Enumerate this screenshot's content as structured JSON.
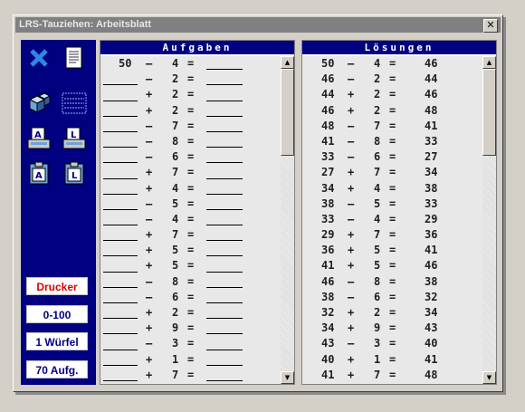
{
  "window": {
    "title": "LRS-Tauziehen: Arbeitsblatt",
    "close_label": "✕"
  },
  "sidebar": {
    "icons": [
      "close-x-icon",
      "document-icon",
      "cubes-icon",
      "grid-icon",
      "print-a-icon",
      "print-l-icon",
      "clipboard-a-icon",
      "clipboard-l-icon"
    ],
    "buttons": [
      {
        "label": "Drucker",
        "color": "#e00000"
      },
      {
        "label": "0-100"
      },
      {
        "label": "1 Würfel"
      },
      {
        "label": "70 Aufg."
      }
    ]
  },
  "tasks": {
    "header": "Aufgaben",
    "rows": [
      {
        "a": "50",
        "op": "–",
        "b": "4",
        "eq": "="
      },
      {
        "a": "",
        "op": "–",
        "b": "2",
        "eq": "="
      },
      {
        "a": "",
        "op": "+",
        "b": "2",
        "eq": "="
      },
      {
        "a": "",
        "op": "+",
        "b": "2",
        "eq": "="
      },
      {
        "a": "",
        "op": "–",
        "b": "7",
        "eq": "="
      },
      {
        "a": "",
        "op": "–",
        "b": "8",
        "eq": "="
      },
      {
        "a": "",
        "op": "–",
        "b": "6",
        "eq": "="
      },
      {
        "a": "",
        "op": "+",
        "b": "7",
        "eq": "="
      },
      {
        "a": "",
        "op": "+",
        "b": "4",
        "eq": "="
      },
      {
        "a": "",
        "op": "–",
        "b": "5",
        "eq": "="
      },
      {
        "a": "",
        "op": "–",
        "b": "4",
        "eq": "="
      },
      {
        "a": "",
        "op": "+",
        "b": "7",
        "eq": "="
      },
      {
        "a": "",
        "op": "+",
        "b": "5",
        "eq": "="
      },
      {
        "a": "",
        "op": "+",
        "b": "5",
        "eq": "="
      },
      {
        "a": "",
        "op": "–",
        "b": "8",
        "eq": "="
      },
      {
        "a": "",
        "op": "–",
        "b": "6",
        "eq": "="
      },
      {
        "a": "",
        "op": "+",
        "b": "2",
        "eq": "="
      },
      {
        "a": "",
        "op": "+",
        "b": "9",
        "eq": "="
      },
      {
        "a": "",
        "op": "–",
        "b": "3",
        "eq": "="
      },
      {
        "a": "",
        "op": "+",
        "b": "1",
        "eq": "="
      },
      {
        "a": "",
        "op": "+",
        "b": "7",
        "eq": "="
      }
    ]
  },
  "solutions": {
    "header": "Lösungen",
    "rows": [
      {
        "a": "50",
        "op": "–",
        "b": "4",
        "eq": "=",
        "r": "46"
      },
      {
        "a": "46",
        "op": "–",
        "b": "2",
        "eq": "=",
        "r": "44"
      },
      {
        "a": "44",
        "op": "+",
        "b": "2",
        "eq": "=",
        "r": "46"
      },
      {
        "a": "46",
        "op": "+",
        "b": "2",
        "eq": "=",
        "r": "48"
      },
      {
        "a": "48",
        "op": "–",
        "b": "7",
        "eq": "=",
        "r": "41"
      },
      {
        "a": "41",
        "op": "–",
        "b": "8",
        "eq": "=",
        "r": "33"
      },
      {
        "a": "33",
        "op": "–",
        "b": "6",
        "eq": "=",
        "r": "27"
      },
      {
        "a": "27",
        "op": "+",
        "b": "7",
        "eq": "=",
        "r": "34"
      },
      {
        "a": "34",
        "op": "+",
        "b": "4",
        "eq": "=",
        "r": "38"
      },
      {
        "a": "38",
        "op": "–",
        "b": "5",
        "eq": "=",
        "r": "33"
      },
      {
        "a": "33",
        "op": "–",
        "b": "4",
        "eq": "=",
        "r": "29"
      },
      {
        "a": "29",
        "op": "+",
        "b": "7",
        "eq": "=",
        "r": "36"
      },
      {
        "a": "36",
        "op": "+",
        "b": "5",
        "eq": "=",
        "r": "41"
      },
      {
        "a": "41",
        "op": "+",
        "b": "5",
        "eq": "=",
        "r": "46"
      },
      {
        "a": "46",
        "op": "–",
        "b": "8",
        "eq": "=",
        "r": "38"
      },
      {
        "a": "38",
        "op": "–",
        "b": "6",
        "eq": "=",
        "r": "32"
      },
      {
        "a": "32",
        "op": "+",
        "b": "2",
        "eq": "=",
        "r": "34"
      },
      {
        "a": "34",
        "op": "+",
        "b": "9",
        "eq": "=",
        "r": "43"
      },
      {
        "a": "43",
        "op": "–",
        "b": "3",
        "eq": "=",
        "r": "40"
      },
      {
        "a": "40",
        "op": "+",
        "b": "1",
        "eq": "=",
        "r": "41"
      },
      {
        "a": "41",
        "op": "+",
        "b": "7",
        "eq": "=",
        "r": "48"
      }
    ]
  },
  "scroll": {
    "up": "▲",
    "down": "▼"
  }
}
